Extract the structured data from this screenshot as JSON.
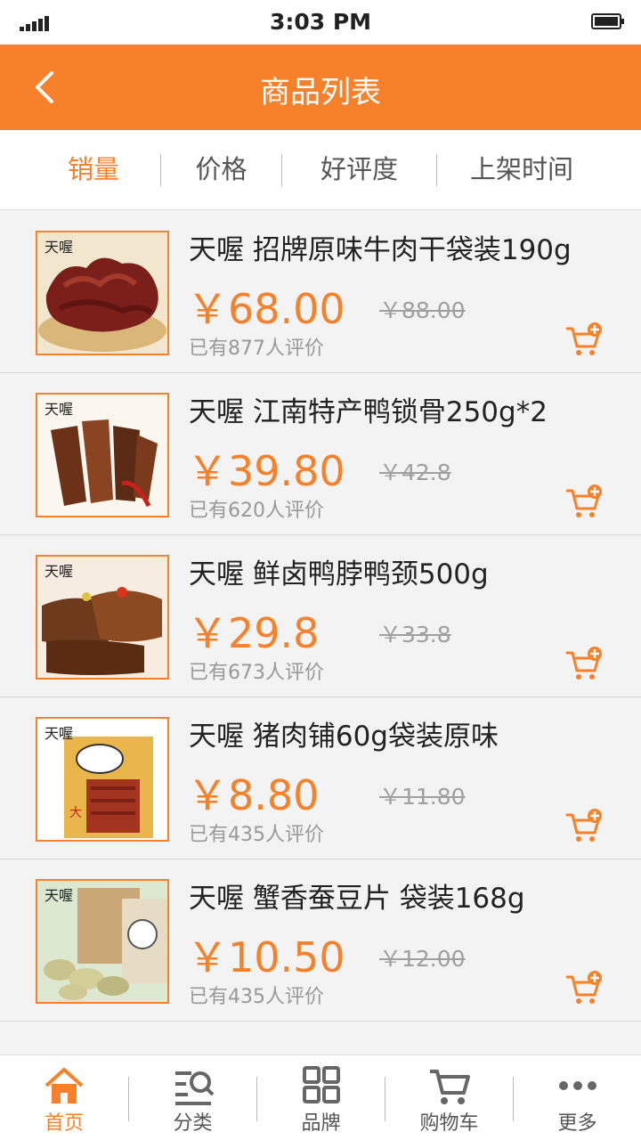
{
  "status_bar": {
    "time": "3:03 PM"
  },
  "header": {
    "title": "商品列表"
  },
  "sort_tabs": [
    {
      "label": "销量",
      "active": true
    },
    {
      "label": "价格",
      "active": false
    },
    {
      "label": "好评度",
      "active": false
    },
    {
      "label": "上架时间",
      "active": false
    }
  ],
  "products": [
    {
      "name": "天喔 招牌原味牛肉干袋装190g",
      "price": "￥68.00",
      "original_price": "￥88.00",
      "reviews": "已有877人评价",
      "image_icon": "beef-jerky-photo"
    },
    {
      "name": "天喔 江南特产鸭锁骨250g*2",
      "price": "￥39.80",
      "original_price": "￥42.8",
      "reviews": "已有620人评价",
      "image_icon": "duck-collarbone-photo"
    },
    {
      "name": "天喔 鲜卤鸭脖鸭颈500g",
      "price": "￥29.8",
      "original_price": "￥33.8",
      "reviews": "已有673人评价",
      "image_icon": "duck-neck-photo"
    },
    {
      "name": "天喔 猪肉铺60g袋装原味",
      "price": "￥8.80",
      "original_price": "￥11.80",
      "reviews": "已有435人评价",
      "image_icon": "pork-jerky-photo"
    },
    {
      "name": "天喔 蟹香蚕豆片 袋装168g",
      "price": "￥10.50",
      "original_price": "￥12.00",
      "reviews": "已有435人评价",
      "image_icon": "broad-beans-photo"
    }
  ],
  "tab_bar": [
    {
      "label": "首页",
      "icon": "home-icon",
      "active": true
    },
    {
      "label": "分类",
      "icon": "category-search-icon",
      "active": false
    },
    {
      "label": "品牌",
      "icon": "grid-icon",
      "active": false
    },
    {
      "label": "购物车",
      "icon": "cart-icon",
      "active": false
    },
    {
      "label": "更多",
      "icon": "more-icon",
      "active": false
    }
  ],
  "colors": {
    "accent": "#f7802a",
    "background": "#f3f3f3"
  }
}
